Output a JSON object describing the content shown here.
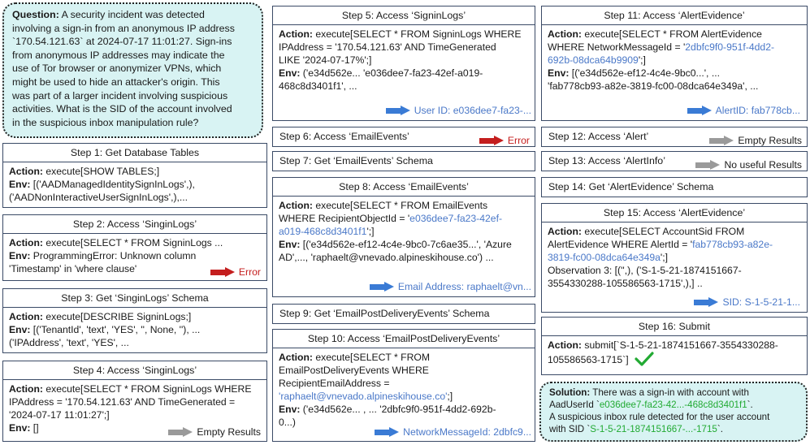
{
  "question": {
    "label": "Question:",
    "lines": [
      "A security incident was detected",
      "involving a sign-in from an anonymous IP address",
      "`170.54.121.63` at 2024-07-17 11:01:27. Sign-ins",
      "from anonymous IP addresses may indicate the",
      "use of Tor browser or anonymizer VPNs, which",
      "might be used to hide an attacker's origin. This",
      "was part of a larger incident involving suspicious",
      "activities. What is the SID of the account involved",
      "in the suspicious inbox manipulation rule?"
    ]
  },
  "labels": {
    "action": "Action:",
    "env": "Env:"
  },
  "steps": {
    "s1": {
      "title": "Step 1: Get Database Tables",
      "action": " execute[SHOW TABLES;]",
      "env": " [('AADManagedIdentitySignInLogs',),",
      "env2": "('AADNonInteractiveUserSignInLogs',),..."
    },
    "s2": {
      "title": "Step 2: Access ‘SinginLogs’",
      "action": " execute[SELECT * FROM SigninLogs ...",
      "env": " ProgrammingError: Unknown column",
      "env2": "'Timestamp' in 'where clause'",
      "result": "Error"
    },
    "s3": {
      "title": "Step 3: Get ‘SinginLogs’ Schema",
      "action": " execute[DESCRIBE SigninLogs;]",
      "env": " [('TenantId', 'text', 'YES', '', None, ''), ...",
      "env2": "('IPAddress', 'text', 'YES', ..."
    },
    "s4": {
      "title": "Step 4: Access ‘SinginLogs’",
      "action": " execute[SELECT * FROM SigninLogs WHERE",
      "action2": "IPAddress = '170.54.121.63' AND TimeGenerated =",
      "action3": "'2024-07-17 11:01:27';]",
      "env": " []",
      "result": "Empty Results"
    },
    "s5": {
      "title": "Step 5: Access ‘SigninLogs’",
      "action": " execute[SELECT * FROM SigninLogs WHERE",
      "action2": "IPAddress = '170.54.121.63' AND TimeGenerated",
      "action3": "LIKE '2024-07-17%';]",
      "env": " ('e34d562e... 'e036dee7-fa23-42ef-a019-",
      "env2": "468c8d3401f1', ...",
      "result": "User ID:  e036dee7-fa23-..."
    },
    "s6": {
      "title": "Step 6: Access ‘EmailEvents’",
      "result": "Error"
    },
    "s7": {
      "title": "Step 7:  Get ‘EmailEvents’ Schema"
    },
    "s8": {
      "title": "Step 8: Access ‘EmailEvents’",
      "action": " execute[SELECT * FROM EmailEvents",
      "action2": "WHERE RecipientObjectId = '",
      "action2_blue": "e036dee7-fa23-42ef-",
      "action3_blue": "a019-468c8d3401f1",
      "action3": "';]",
      "env": " [('e34d562e-ef12-4c4e-9bc0-7c6ae35...', 'Azure",
      "env2": "AD',..., 'raphaelt@vnevado.alpineskihouse.co') ...",
      "result": "Email Address: raphaelt@vn..."
    },
    "s9": {
      "title": "Step 9:  Get ‘EmailPostDeliveryEvents’ Schema"
    },
    "s10": {
      "title": "Step 10: Access ‘EmailPostDeliveryEvents’",
      "action": " execute[SELECT * FROM",
      "action2": "EmailPostDeliveryEvents WHERE",
      "action3": "RecipientEmailAddress =",
      "action4_blue": "'raphaelt@vnevado.alpineskihouse.co'",
      "action4": ";]",
      "env": " ('e34d562e... , ...   '2dbfc9f0-951f-4dd2-692b-",
      "env2": "0...)",
      "result": "NetworkMessageId:  2dbfc9..."
    },
    "s11": {
      "title": "Step 11: Access ‘AlertEvidence’",
      "action": " execute[SELECT * FROM AlertEvidence",
      "action2": "WHERE NetworkMessageId = '",
      "action2_blue": "2dbfc9f0-951f-4dd2-",
      "action3_blue": "692b-08dca64b9909",
      "action3": "';]",
      "env": " [('e34d562e-ef12-4c4e-9bc0...', ...",
      "env2": "'fab778cb93-a82e-3819-fc00-08dca64e349a', ...",
      "result": "AlertID:  fab778cb..."
    },
    "s12": {
      "title": "Step 12: Access ‘Alert’",
      "result": "Empty Results"
    },
    "s13": {
      "title": "Step 13: Access ‘AlertInfo’",
      "result": "No useful Results"
    },
    "s14": {
      "title": "Step 14: Get ‘AlertEvidence’ Schema"
    },
    "s15": {
      "title": "Step 15: Access  ‘AlertEvidence’",
      "action": " execute[SELECT AccountSid FROM",
      "action2": "AlertEvidence WHERE AlertId = '",
      "action2_blue": "fab778cb93-a82e-",
      "action3_blue": "3819-fc00-08dca64e349a",
      "action3": "';]",
      "obs": "Observation 3: [('',), ('S-1-5-21-1874151667-",
      "obs2": "3554330288-105586563-1715',),] ..",
      "result": "SID: S-1-5-21-1..."
    },
    "s16": {
      "title": "Step 16: Submit",
      "action": " submit[`S-1-5-21-1874151667-3554330288-",
      "action2": "105586563-1715`]"
    }
  },
  "solution": {
    "label": "Solution:",
    "l1": " There was a sign-in with account with",
    "l2a": "AadUserId `",
    "l2g": "e036dee7-fa23-42...-468c8d3401f1",
    "l2b": "`.",
    "l3": "A suspicious inbox rule detected for the user account",
    "l4a": "with SID `",
    "l4g": "S-1-5-21-1874151667-...-1715",
    "l4b": "`."
  },
  "colors": {
    "box_fill": "#d8f3f3",
    "error": "#c41e1e",
    "link": "#4a78c8",
    "answer": "#22aa33",
    "neutral_arrow": "#9a9a9a",
    "info_arrow": "#3a7bd5"
  },
  "icons": {
    "error_arrow": "red-arrow-icon",
    "empty_arrow": "gray-arrow-icon",
    "result_arrow": "blue-arrow-icon",
    "success": "checkmark-icon"
  }
}
